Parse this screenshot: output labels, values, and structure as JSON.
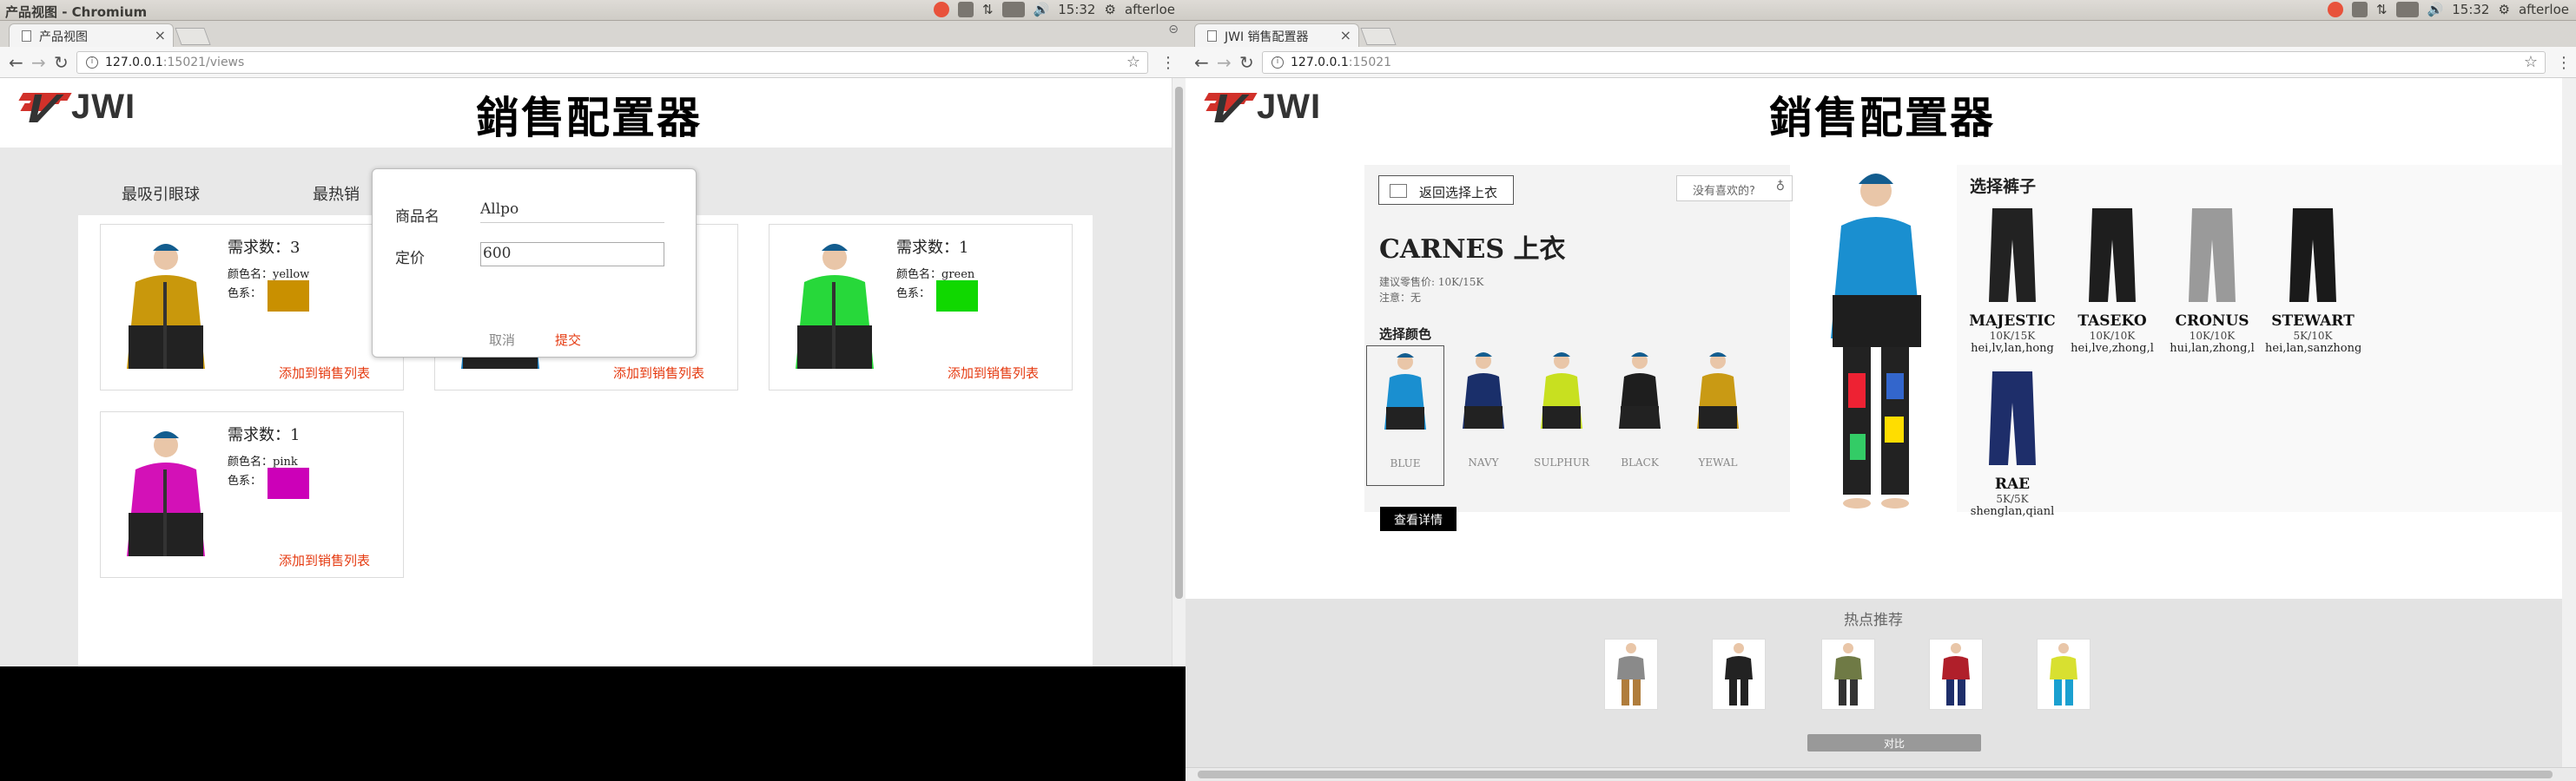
{
  "left": {
    "os_title": "产品视图 - Chromium",
    "tray": {
      "time": "15:32",
      "user": "afterloe"
    },
    "tab_title": "产品视图",
    "url_host": "127.0.0.1",
    "url_port_path": ":15021/views",
    "page_title": "銷售配置器",
    "logo_text": "JWI",
    "tabs": [
      "最吸引眼球",
      "最热销"
    ],
    "cards": [
      {
        "demand": "需求数：3",
        "color_name": "颜色名：yellow",
        "color_label": "色系：",
        "swatch": "#c99000",
        "jacket": "#c9980c",
        "add": "添加到销售列表"
      },
      {
        "demand": "",
        "color_name": "",
        "color_label": "",
        "swatch": "",
        "jacket": "#1a7ec0",
        "add": "添加到销售列表"
      },
      {
        "demand": "需求数：1",
        "color_name": "颜色名：green",
        "color_label": "色系：",
        "swatch": "#10d800",
        "jacket": "#27d83a",
        "add": "添加到销售列表"
      },
      {
        "demand": "需求数：1",
        "color_name": "颜色名：pink",
        "color_label": "色系：",
        "swatch": "#cc00b8",
        "jacket": "#d311b7",
        "add": "添加到销售列表"
      }
    ],
    "modal": {
      "name_label": "商品名",
      "name_value": "Allpo",
      "price_label": "定价",
      "price_value": "600",
      "cancel": "取消",
      "submit": "提交"
    }
  },
  "right": {
    "tray": {
      "time": "15:32",
      "user": "afterloe"
    },
    "tab_title": "JWI 销售配置器",
    "url_host": "127.0.0.1",
    "url_port_path": ":15021",
    "page_title": "銷售配置器",
    "logo_text": "JWI",
    "back_button": "返回选择上衣",
    "no_like": "没有喜欢的?",
    "product_name": "CARNES 上衣",
    "price_line": "建议零售价: 10K/15K",
    "note_line": "注意：无",
    "color_section": "选择颜色",
    "colors": [
      {
        "name": "BLUE",
        "hex": "#1a8fd0"
      },
      {
        "name": "NAVY",
        "hex": "#1a2f6a"
      },
      {
        "name": "SULPHUR",
        "hex": "#c8e020"
      },
      {
        "name": "BLACK",
        "hex": "#1e1e1e"
      },
      {
        "name": "YEWAL",
        "hex": "#c99a14"
      }
    ],
    "detail_button": "查看详情",
    "pants_section": "选择裤子",
    "pants": [
      {
        "name": "MAJESTIC",
        "price": "10K/15K",
        "colors": "hei,lv,lan,hong",
        "hex": "#222"
      },
      {
        "name": "TASEKO",
        "price": "10K/10K",
        "colors": "hei,lve,zhong,l",
        "hex": "#1e1e1e"
      },
      {
        "name": "CRONUS",
        "price": "10K/10K",
        "colors": "hui,lan,zhong,l",
        "hex": "#9a9a9a"
      },
      {
        "name": "STEWART",
        "price": "5K/10K",
        "colors": "hei,lan,sanzhong",
        "hex": "#1a1a1a"
      },
      {
        "name": "RAE",
        "price": "5K/5K",
        "colors": "shenglan,qianl",
        "hex": "#1e2e6a"
      }
    ],
    "hot_title": "热点推荐",
    "hot": [
      {
        "top": "#8a8a8a",
        "bottom": "#b07d3c"
      },
      {
        "top": "#222",
        "bottom": "#222"
      },
      {
        "top": "#6f7a45",
        "bottom": "#333"
      },
      {
        "top": "#b01f2a",
        "bottom": "#1e2e6a"
      },
      {
        "top": "#d8e030",
        "bottom": "#1aa0d0"
      }
    ],
    "compare_button": "对比"
  }
}
